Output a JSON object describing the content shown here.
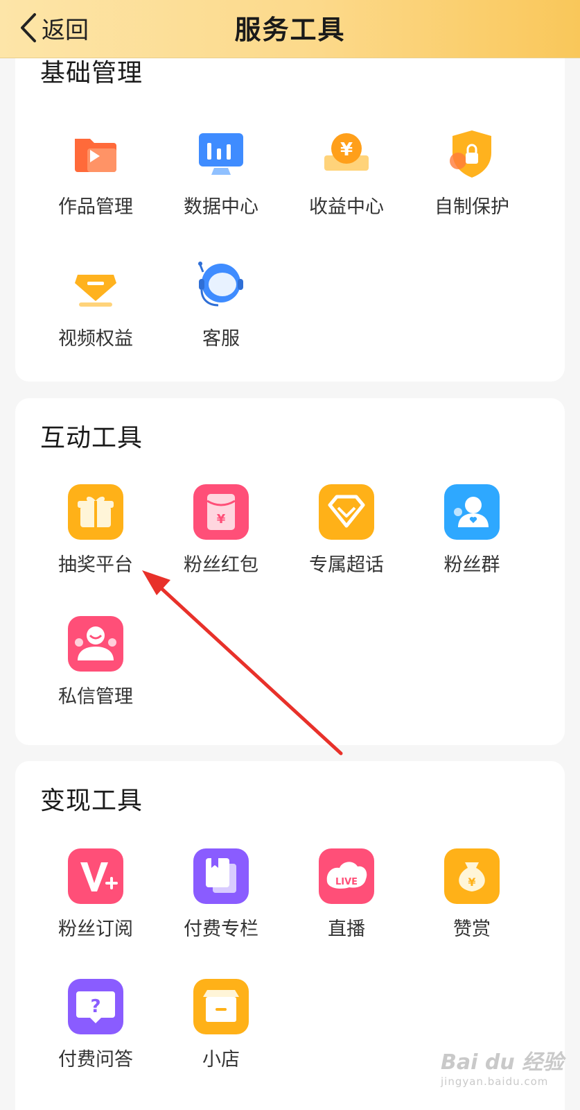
{
  "header": {
    "back_label": "返回",
    "title": "服务工具"
  },
  "sections": {
    "basic": {
      "title": "基础管理",
      "items": [
        {
          "label": "作品管理",
          "icon": "works-folder-icon"
        },
        {
          "label": "数据中心",
          "icon": "data-chart-icon"
        },
        {
          "label": "收益中心",
          "icon": "yuan-coin-icon"
        },
        {
          "label": "自制保护",
          "icon": "shield-lock-icon"
        },
        {
          "label": "视频权益",
          "icon": "diamond-icon"
        },
        {
          "label": "客服",
          "icon": "headset-icon"
        }
      ]
    },
    "interactive": {
      "title": "互动工具",
      "items": [
        {
          "label": "抽奖平台",
          "icon": "gift-box-icon"
        },
        {
          "label": "粉丝红包",
          "icon": "red-envelope-icon"
        },
        {
          "label": "专属超话",
          "icon": "super-topic-diamond-icon"
        },
        {
          "label": "粉丝群",
          "icon": "fan-group-icon"
        },
        {
          "label": "私信管理",
          "icon": "message-user-icon"
        }
      ]
    },
    "monetize": {
      "title": "变现工具",
      "items": [
        {
          "label": "粉丝订阅",
          "icon": "v-plus-icon"
        },
        {
          "label": "付费专栏",
          "icon": "column-book-icon"
        },
        {
          "label": "直播",
          "icon": "live-icon",
          "badge_text": "LIVE"
        },
        {
          "label": "赞赏",
          "icon": "money-bag-icon"
        },
        {
          "label": "付费问答",
          "icon": "question-bubble-icon"
        },
        {
          "label": "小店",
          "icon": "shop-icon"
        }
      ]
    }
  },
  "watermark": {
    "logo": "Bai du 经验",
    "sub": "jingyan.baidu.com"
  },
  "colors": {
    "header_start": "#fde5a8",
    "header_end": "#f9c75a",
    "arrow": "#e8312a"
  }
}
